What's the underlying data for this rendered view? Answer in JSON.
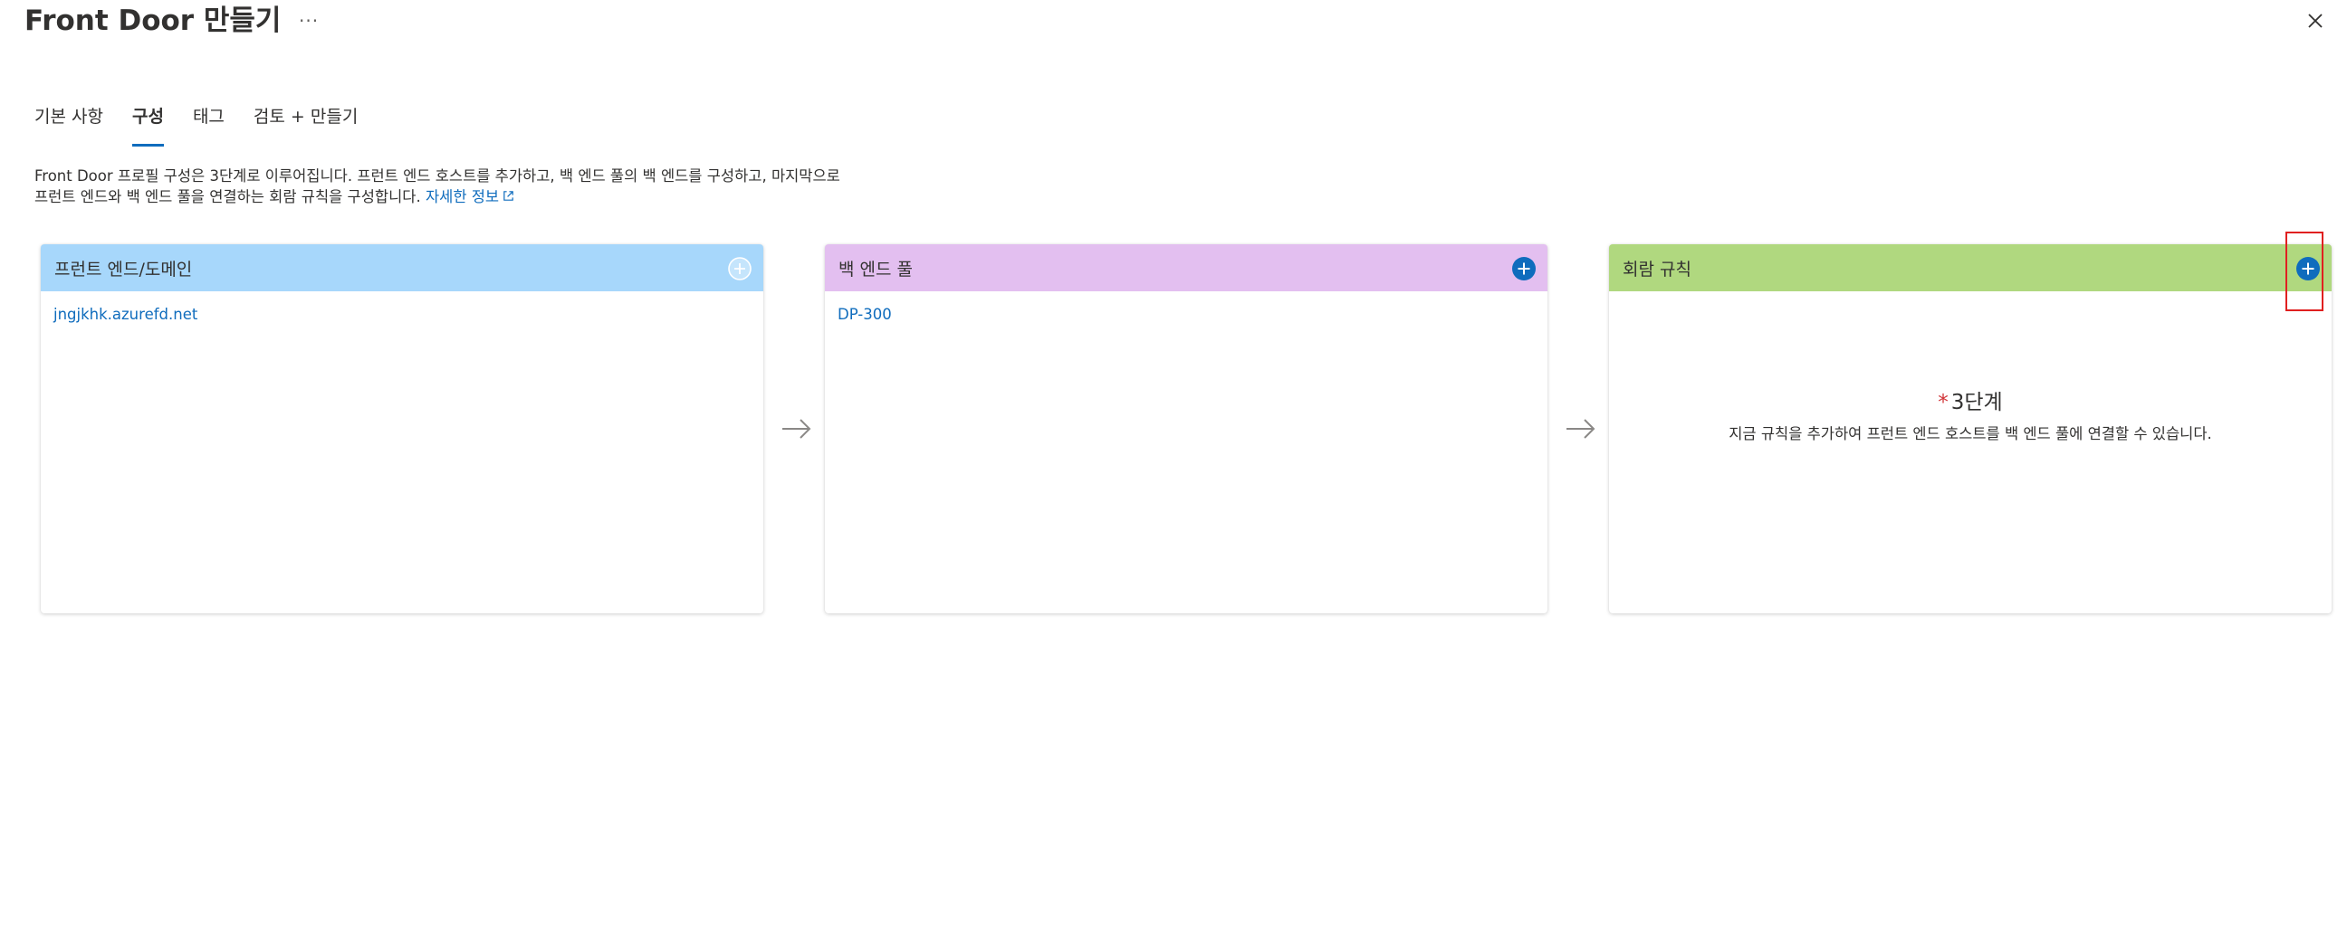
{
  "header": {
    "title": "Front Door 만들기",
    "more_label": "···"
  },
  "tabs": [
    {
      "label": "기본 사항",
      "active": false
    },
    {
      "label": "구성",
      "active": true
    },
    {
      "label": "태그",
      "active": false
    },
    {
      "label": "검토 + 만들기",
      "active": false
    }
  ],
  "description": {
    "line1": "Front Door 프로필 구성은 3단계로 이루어집니다. 프런트 엔드 호스트를 추가하고, 백 엔드 풀의 백 엔드를 구성하고, 마지막으로",
    "line2": "프런트 엔드와 백 엔드 풀을 연결하는 회람 규칙을 구성합니다.",
    "learn_more": "자세한 정보"
  },
  "cards": {
    "frontend": {
      "title": "프런트 엔드/도메인",
      "item": "jngjkhk.azurefd.net",
      "header_color": "#a7d7fb",
      "add_enabled": false
    },
    "backend": {
      "title": "백 엔드 풀",
      "item": "DP-300",
      "header_color": "#e3bff0",
      "add_enabled": true
    },
    "routing": {
      "title": "회람 규칙",
      "step_required": "*",
      "step_title": "3단계",
      "step_desc": "지금 규칙을 추가하여 프런트 엔드 호스트를 백 엔드 풀에 연결할 수 있습니다.",
      "header_color": "#b0d87f",
      "add_enabled": true
    }
  },
  "colors": {
    "accent": "#0f6cbd",
    "highlight": "#e02020"
  }
}
